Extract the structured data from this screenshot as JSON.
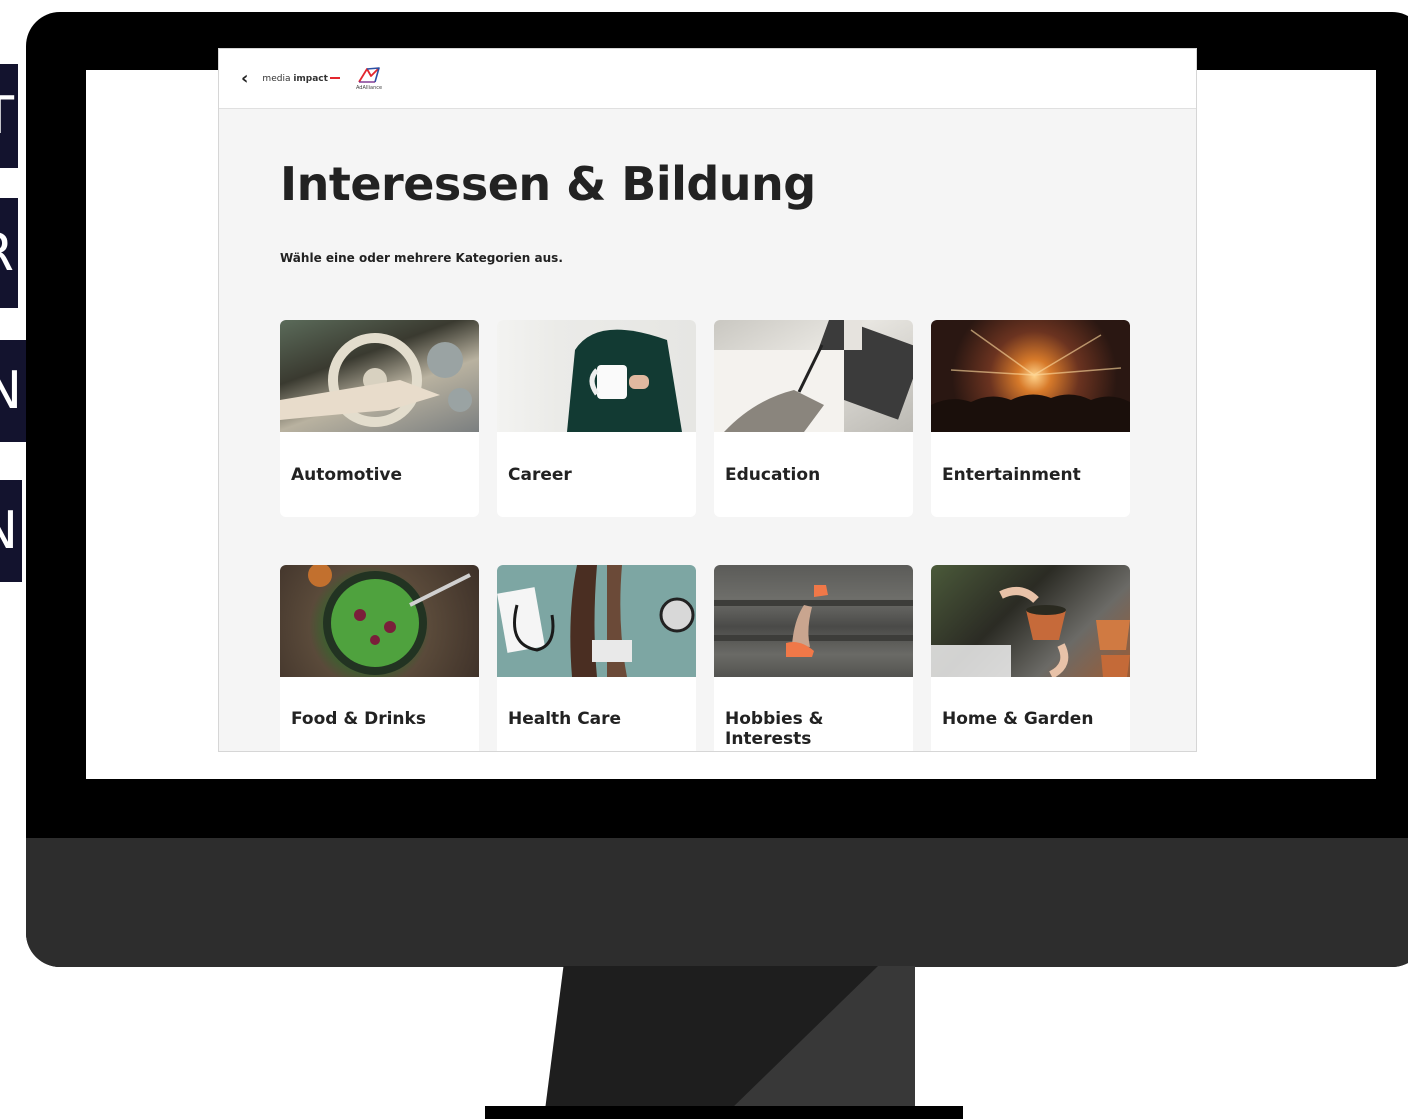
{
  "side_tiles": [
    "T",
    "R",
    "N",
    "N"
  ],
  "header": {
    "back_label": "‹",
    "brand": {
      "prefix": "media ",
      "name": "impact",
      "partner": "AdAlliance"
    }
  },
  "page": {
    "title": "Interessen & Bildung",
    "subtitle": "Wähle eine oder mehrere Kategorien aus."
  },
  "categories": [
    {
      "label": "Automotive"
    },
    {
      "label": "Career"
    },
    {
      "label": "Education"
    },
    {
      "label": "Entertainment"
    },
    {
      "label": "Food & Drinks"
    },
    {
      "label": "Health Care"
    },
    {
      "label": "Hobbies & Interests"
    },
    {
      "label": "Home & Garden"
    }
  ],
  "colors": {
    "accent_red": "#e3262e",
    "side_tile_bg": "#13132e",
    "card_bg": "#ffffff",
    "content_bg": "#f5f5f5"
  },
  "icons": {
    "back": "chevron-left-icon",
    "partner_logo": "adalliance-logo-icon"
  }
}
